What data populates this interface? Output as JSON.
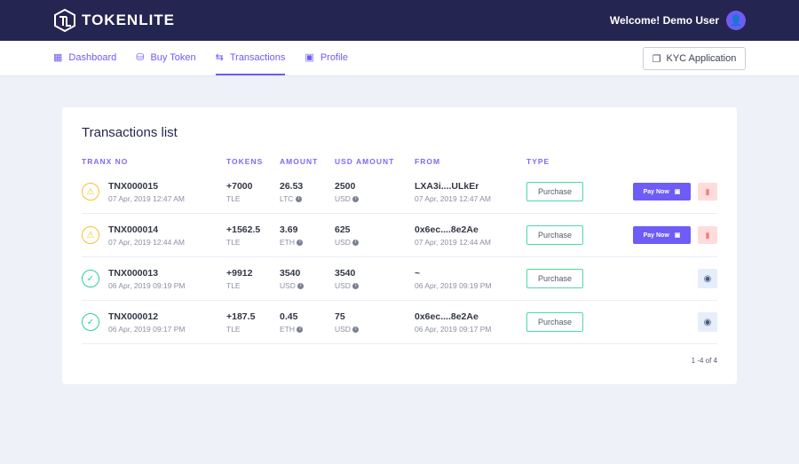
{
  "header": {
    "logo": "TOKENLITE",
    "welcome": "Welcome! Demo User"
  },
  "nav": {
    "items": [
      {
        "label": "Dashboard",
        "icon": "grid-icon"
      },
      {
        "label": "Buy Token",
        "icon": "coins-icon"
      },
      {
        "label": "Transactions",
        "icon": "swap-icon",
        "active": true
      },
      {
        "label": "Profile",
        "icon": "profile-icon"
      }
    ],
    "kyc": "KYC Application"
  },
  "card": {
    "title": "Transactions list",
    "columns": [
      "TRANX NO",
      "TOKENS",
      "AMOUNT",
      "USD AMOUNT",
      "FROM",
      "TYPE"
    ],
    "rows": [
      {
        "status": "pending",
        "id": "TNX000015",
        "date": "07 Apr, 2019 12:47 AM",
        "tokens": "+7000",
        "token_unit": "TLE",
        "amount": "26.53",
        "amount_unit": "LTC",
        "usd": "2500",
        "usd_unit": "USD",
        "from": "LXA3i....ULkEr",
        "from_date": "07 Apr, 2019 12:47 AM",
        "type": "Purchase",
        "pay": "Pay Now"
      },
      {
        "status": "pending",
        "id": "TNX000014",
        "date": "07 Apr, 2019 12:44 AM",
        "tokens": "+1562.5",
        "token_unit": "TLE",
        "amount": "3.69",
        "amount_unit": "ETH",
        "usd": "625",
        "usd_unit": "USD",
        "from": "0x6ec....8e2Ae",
        "from_date": "07 Apr, 2019 12:44 AM",
        "type": "Purchase",
        "pay": "Pay Now"
      },
      {
        "status": "approved",
        "id": "TNX000013",
        "date": "06 Apr, 2019 09:19 PM",
        "tokens": "+9912",
        "token_unit": "TLE",
        "amount": "3540",
        "amount_unit": "USD",
        "usd": "3540",
        "usd_unit": "USD",
        "from": "~",
        "from_date": "06 Apr, 2019 09:19 PM",
        "type": "Purchase"
      },
      {
        "status": "approved",
        "id": "TNX000012",
        "date": "06 Apr, 2019 09:17 PM",
        "tokens": "+187.5",
        "token_unit": "TLE",
        "amount": "0.45",
        "amount_unit": "ETH",
        "usd": "75",
        "usd_unit": "USD",
        "from": "0x6ec....8e2Ae",
        "from_date": "06 Apr, 2019 09:17 PM",
        "type": "Purchase"
      }
    ],
    "pagination": "1 -4 of 4"
  },
  "colors": {
    "header": "#252551",
    "accent": "#6e5cf7",
    "pending": "#f7c02b",
    "approved": "#2ad19a"
  }
}
